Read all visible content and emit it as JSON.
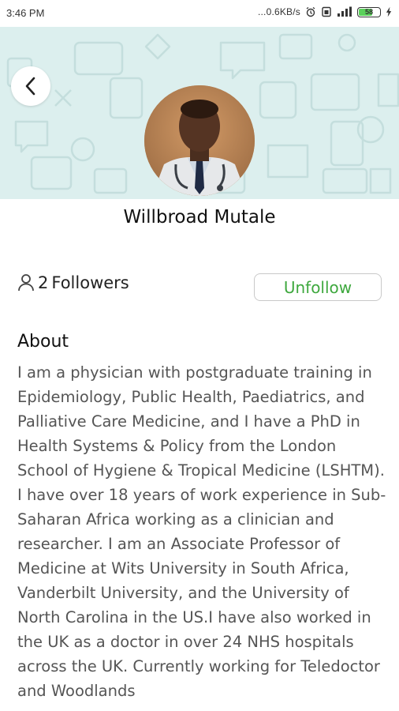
{
  "status_bar": {
    "time": "3:46 PM",
    "net_speed": "...0.6KB/s",
    "battery_level": "58"
  },
  "profile": {
    "name": "Willbroad Mutale",
    "followers_count": "2",
    "followers_label": "Followers"
  },
  "actions": {
    "unfollow_label": "Unfollow"
  },
  "about": {
    "heading": "About",
    "text": "I am a physician with postgraduate training in Epidemiology, Public Health, Paediatrics, and Palliative Care Medicine, and I have a PhD in Health Systems & Policy from the London School of Hygiene & Tropical Medicine (LSHTM). I have over 18 years of work experience in Sub-Saharan Africa working as a clinician and researcher. I am an Associate Professor of Medicine at Wits University in South Africa, Vanderbilt University, and the University of North Carolina in the US.I have also worked in the UK as a doctor in over 24 NHS hospitals across the UK. Currently working for Teledoctor and Woodlands"
  },
  "colors": {
    "accent_green": "#3ea83e",
    "banner_bg": "#dcefee"
  },
  "icons": {
    "back": "chevron-left-icon",
    "followers": "person-outline-icon"
  }
}
